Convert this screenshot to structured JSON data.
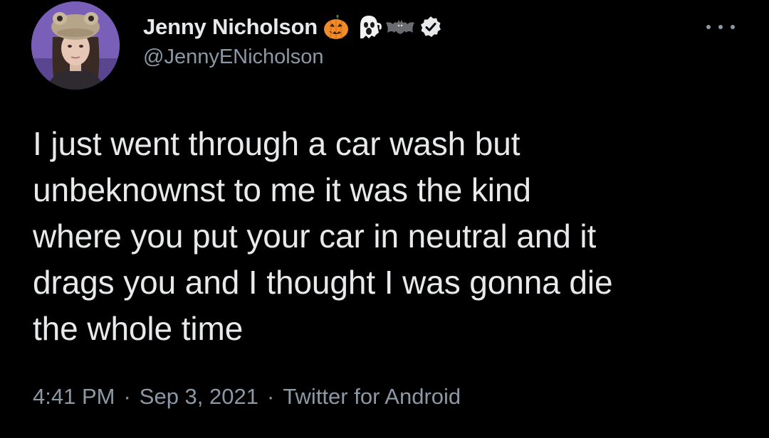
{
  "author": {
    "display_name": "Jenny Nicholson",
    "handle": "@JennyENicholson",
    "name_emojis": [
      "jack-o-lantern-icon",
      "ghost-icon",
      "bat-icon"
    ],
    "verified": true
  },
  "tweet": {
    "text": "I just went through a car wash but\nunbeknownst to me it was the kind\nwhere you put your car in neutral and it\ndrags you and I thought I was gonna die\nthe whole time"
  },
  "meta": {
    "time": "4:41 PM",
    "separator": "·",
    "date": "Sep 3, 2021",
    "source": "Twitter for Android"
  },
  "colors": {
    "background": "#000000",
    "primary_text": "#e7e9ea",
    "secondary_text": "#8b98a5",
    "verified_badge": "#e7e9ea"
  }
}
